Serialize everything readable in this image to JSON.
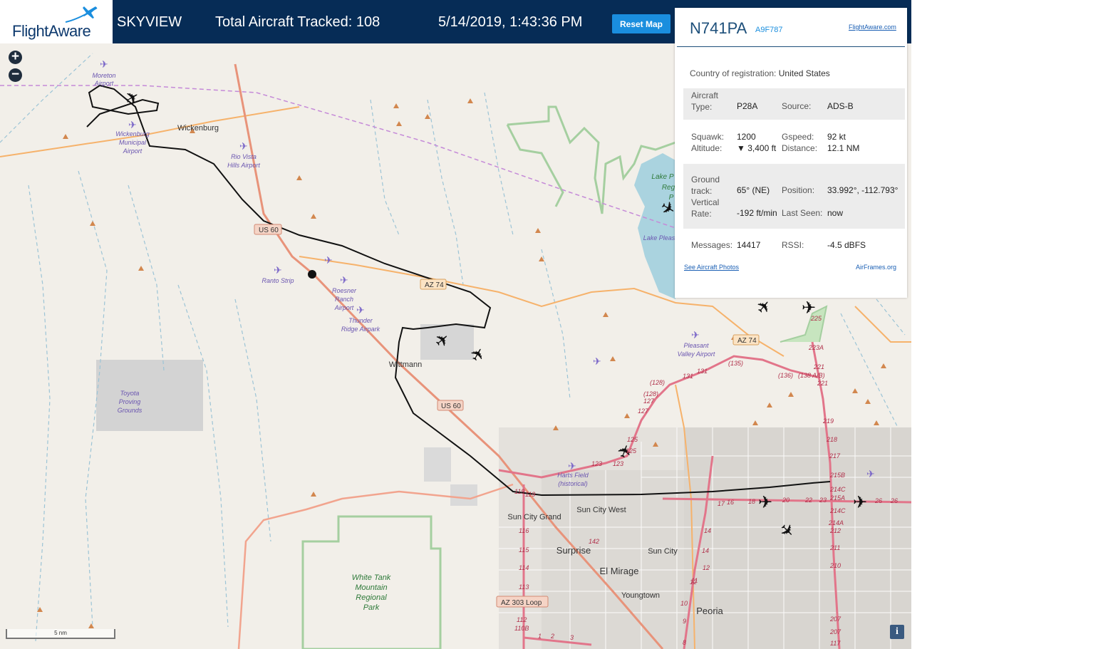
{
  "header": {
    "logo_text": "FlightAware",
    "title": "SKYVIEW",
    "total_tracked": "Total Aircraft Tracked: 108",
    "datetime": "5/14/2019, 1:43:36 PM",
    "reset_label": "Reset Map"
  },
  "zoom": {
    "in": "+",
    "out": "−"
  },
  "scale_label": "5 nm",
  "info_label": "i",
  "panel": {
    "registration": "N741PA",
    "hex": "A9F787",
    "site_link": "FlightAware.com",
    "country_label": "Country of registration:",
    "country_value": "United States",
    "aircraft_type_label": "Aircraft Type:",
    "aircraft_type_value": "P28A",
    "source_label": "Source:",
    "source_value": "ADS-B",
    "squawk_label": "Squawk:",
    "squawk_value": "1200",
    "gspeed_label": "Gspeed:",
    "gspeed_value": "92 kt",
    "altitude_label": "Altitude:",
    "altitude_value": "▼ 3,400 ft",
    "distance_label": "Distance:",
    "distance_value": "12.1 NM",
    "track_label": "Ground track:",
    "track_value": "65° (NE)",
    "position_label": "Position:",
    "position_value": "33.992°, -112.793°",
    "vrate_label": "Vertical Rate:",
    "vrate_value": "-192 ft/min",
    "lastseen_label": "Last Seen:",
    "lastseen_value": "now",
    "messages_label": "Messages:",
    "messages_value": "14417",
    "rssi_label": "RSSI:",
    "rssi_value": "-4.5 dBFS",
    "photos_link": "See Aircraft Photos",
    "airframes_link": "AirFrames.org"
  },
  "map_labels": {
    "moreton": "Moreton",
    "moreton2": "Airport",
    "wickenburg": "Wickenburg",
    "wick_muni1": "Wickenburg",
    "wick_muni2": "Municipal",
    "wick_muni3": "Airport",
    "riovista1": "Rio Vista",
    "riovista2": "Hills Airport",
    "us60a": "US 60",
    "us60b": "US 60",
    "az74a": "AZ 74",
    "az74b": "AZ 74",
    "ranto": "Ranto Strip",
    "roesner1": "Roesner",
    "roesner2": "Ranch",
    "roesner3": "Airport",
    "thunder1": "Thunder",
    "thunder2": "Ridge Airpark",
    "wittmann": "Wittmann",
    "toyota1": "Toyota",
    "toyota2": "Proving",
    "toyota3": "Grounds",
    "lakep1": "Lake P",
    "lakep2": "Reg",
    "lakep3": "P",
    "lakeplsnt": "Lake Pleas",
    "pleasant1": "Pleasant",
    "pleasant2": "Valley Airport",
    "harts1": "Harts Field",
    "harts2": "(historical)",
    "suncitygrand": "Sun City Grand",
    "suncitywest": "Sun City West",
    "surprise": "Surprise",
    "elmirage": "El Mirage",
    "suncity": "Sun City",
    "youngtown": "Youngtown",
    "peoria": "Peoria",
    "az303": "AZ 303 Loop",
    "whitetank1": "White Tank",
    "whitetank2": "Mountain",
    "whitetank3": "Regional",
    "whitetank4": "Park"
  },
  "colors": {
    "header_bg": "#062c56",
    "accent": "#1a8ede",
    "map_bg": "#f2efe9"
  }
}
